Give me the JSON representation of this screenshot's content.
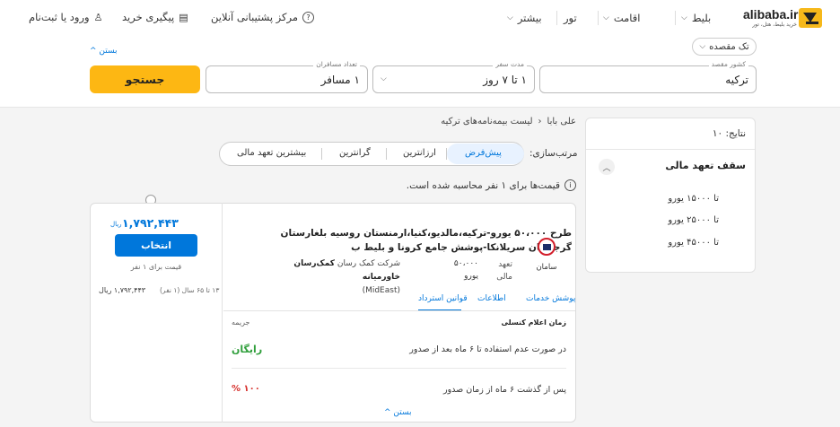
{
  "brand": {
    "name": "alibaba.ir",
    "tagline": "خرید بلیط، هتل، تور"
  },
  "nav": {
    "items": [
      {
        "label": "بلیط"
      },
      {
        "label": "اقامت"
      },
      {
        "label": "تور"
      },
      {
        "label": "بیشتر"
      }
    ],
    "support": "مرکز پشتیبانی آنلاین",
    "track": "پیگیری خرید",
    "login": "ورود یا ثبت‌نام"
  },
  "search": {
    "trip_type": "تک مقصده",
    "collapse": "بستن",
    "destination": {
      "label": "کشور مقصد",
      "value": "ترکیه"
    },
    "duration": {
      "label": "مدت سفر",
      "value": "۱ تا ۷ روز"
    },
    "travelers": {
      "label": "تعداد مسافران",
      "value": "۱ مسافر"
    },
    "button": "جستجو"
  },
  "filter": {
    "results": "نتایج: ۱۰",
    "title": "سقف تعهد مالی",
    "options": [
      {
        "label": "تا ۱۵۰۰۰ یورو"
      },
      {
        "label": "تا ۲۵۰۰۰ یورو"
      },
      {
        "label": "تا ۴۵۰۰۰ یورو"
      }
    ]
  },
  "breadcrumb": {
    "home": "علی بابا",
    "current": "لیست بیمه‌نامه‌های ترکیه"
  },
  "sort": {
    "label": "مرتب‌سازی:",
    "options": [
      "پیش‌فرض",
      "ارزانترین",
      "گرانترین",
      "بیشترین تعهد مالی"
    ],
    "active": "پیش‌فرض"
  },
  "info": "قیمت‌ها برای ۱ نفر محاسبه شده است.",
  "card": {
    "title": "طرح ۵۰،۰۰۰ یورو-ترکیه،مالدیو،کنیا،ارمنستان روسیه بلغارستان گرجستان سریلانکا-پوشش جامع کرونا و بلیط ب",
    "company": "سامان",
    "coverage_label": "تعهد مالی",
    "coverage_value": "۵۰،۰۰۰ یورو",
    "provider_prefix": "شرکت کمک رسان",
    "provider_name": "کمک‌رسان خاورمیانه",
    "provider_suffix": "(MidEast)",
    "price": "۱,۷۹۲,۴۴۳",
    "currency": "ریال",
    "select": "انتخاب",
    "price_note": "قیمت برای ۱ نفر",
    "age_label": "۱۳ تا ۶۵ سال (۱ نفر)",
    "age_price": "۱,۷۹۲,۴۴۳ ریال",
    "tabs": [
      "پوشش خدمات",
      "اطلاعات",
      "قوانین استرداد"
    ],
    "active_tab": "قوانین استرداد",
    "refund": {
      "col1": "زمان اعلام کنسلی",
      "col2": "جریمه",
      "rows": [
        {
          "when": "در صورت عدم استفاده تا ۶ ماه بعد از صدور",
          "penalty": "رایگان",
          "color": "#2e9e3a"
        },
        {
          "when": "پس از گذشت ۶ ماه از زمان صدور",
          "penalty": "۱۰۰ %",
          "color": "#d6312d"
        }
      ]
    },
    "collapse": "بستن"
  }
}
